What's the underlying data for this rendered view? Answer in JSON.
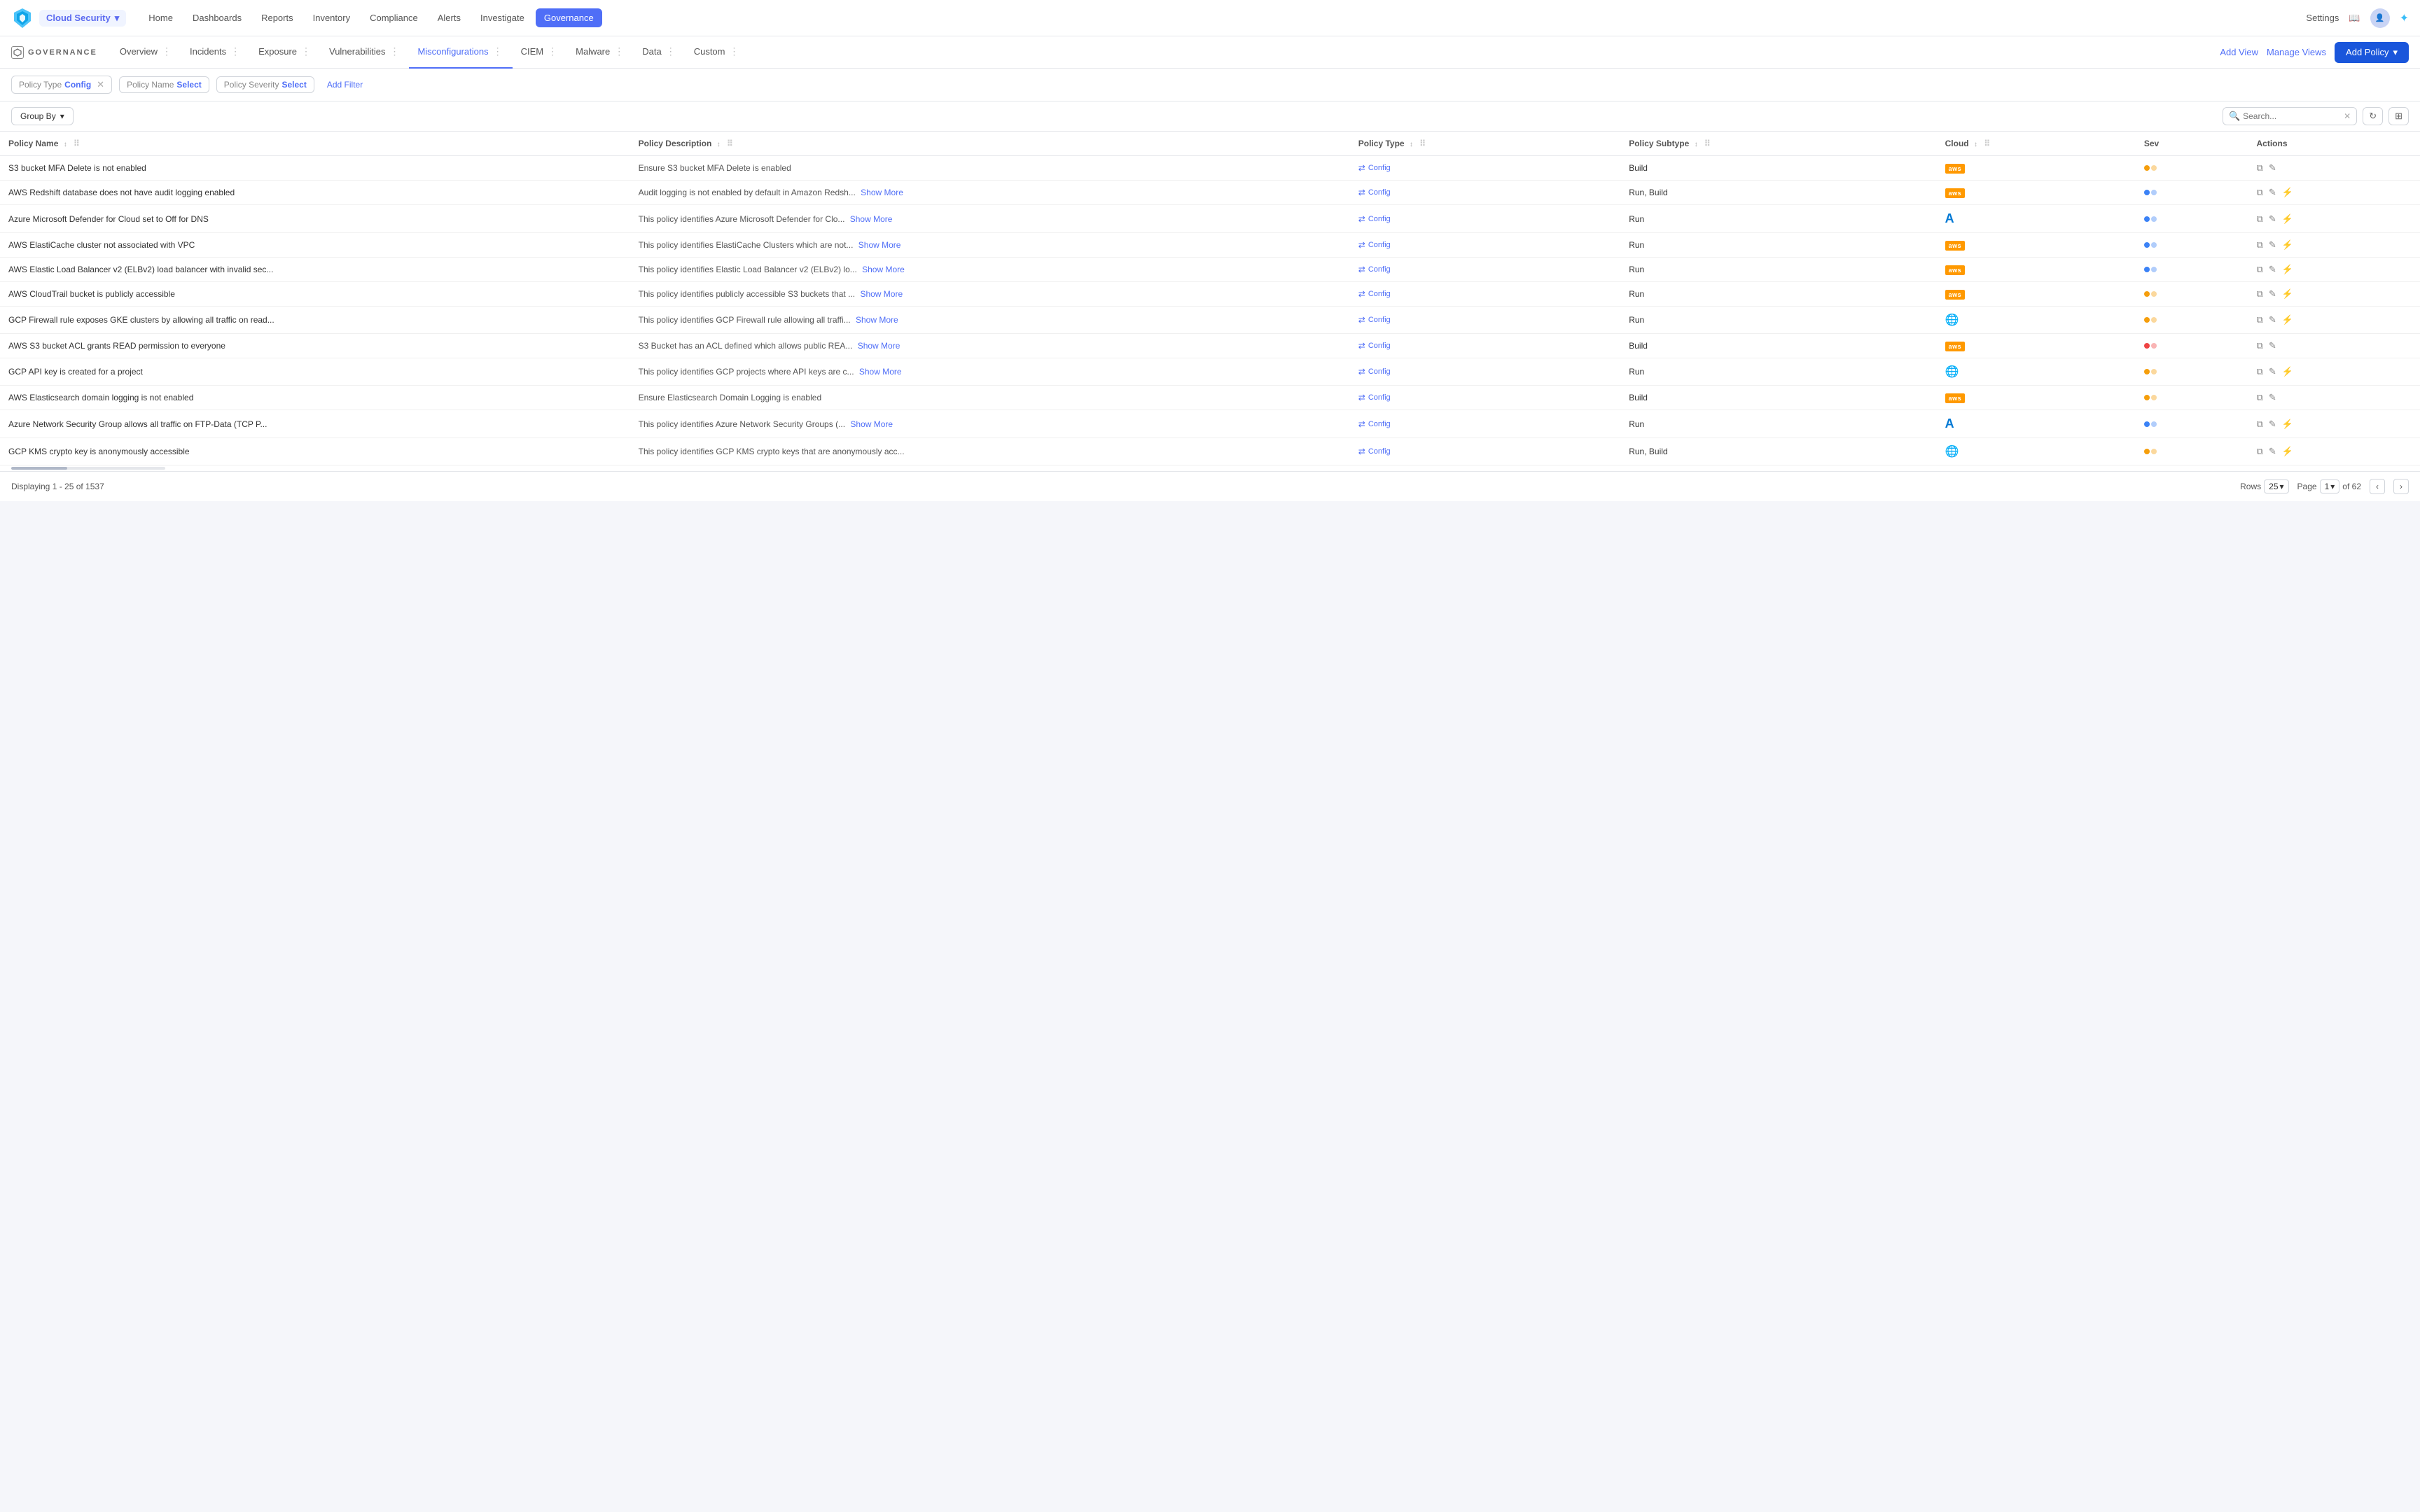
{
  "topNav": {
    "appSwitcher": "Cloud Security",
    "navItems": [
      "Home",
      "Dashboards",
      "Reports",
      "Inventory",
      "Compliance",
      "Alerts",
      "Investigate",
      "Governance"
    ],
    "activeNavItem": "Governance",
    "rightItems": [
      "Settings"
    ],
    "icons": [
      "book-icon",
      "user-icon",
      "star-icon"
    ]
  },
  "subNav": {
    "logoTitle": "GOVERNANCE",
    "items": [
      "Overview",
      "Incidents",
      "Exposure",
      "Vulnerabilities",
      "Misconfigurations",
      "CIEM",
      "Malware",
      "Data",
      "Custom"
    ],
    "activeItem": "Misconfigurations",
    "addViewLabel": "Add View",
    "manageViewsLabel": "Manage Views",
    "addPolicyLabel": "Add Policy"
  },
  "filters": {
    "chips": [
      {
        "label": "Policy Type",
        "value": "Config",
        "removable": true
      },
      {
        "label": "Policy Name",
        "value": "Select",
        "removable": false
      },
      {
        "label": "Policy Severity",
        "value": "Select",
        "removable": false
      }
    ],
    "addFilterLabel": "Add Filter"
  },
  "toolbar": {
    "groupByLabel": "Group By",
    "searchPlaceholder": "Search..."
  },
  "table": {
    "columns": [
      {
        "id": "policy-name",
        "label": "Policy Name",
        "sortable": true
      },
      {
        "id": "policy-description",
        "label": "Policy Description",
        "sortable": true
      },
      {
        "id": "policy-type",
        "label": "Policy Type",
        "sortable": true
      },
      {
        "id": "policy-subtype",
        "label": "Policy Subtype",
        "sortable": true
      },
      {
        "id": "cloud",
        "label": "Cloud",
        "sortable": true
      },
      {
        "id": "severity",
        "label": "Sev",
        "sortable": false
      },
      {
        "id": "actions",
        "label": "Actions",
        "sortable": false
      }
    ],
    "rows": [
      {
        "id": 1,
        "policyName": "S3 bucket MFA Delete is not enabled",
        "policyDescription": "Ensure S3 bucket MFA Delete is enabled",
        "policyType": "Config",
        "policySubtype": "Build",
        "cloud": "aws",
        "severity": "orange",
        "showMore": false
      },
      {
        "id": 2,
        "policyName": "AWS Redshift database does not have audit logging enabled",
        "policyDescription": "Audit logging is not enabled by default in Amazon Redsh...",
        "policyType": "Config",
        "policySubtype": "Run, Build",
        "cloud": "aws",
        "severity": "blue",
        "showMore": true
      },
      {
        "id": 3,
        "policyName": "Azure Microsoft Defender for Cloud set to Off for DNS",
        "policyDescription": "This policy identifies Azure Microsoft Defender for Clo...",
        "policyType": "Config",
        "policySubtype": "Run",
        "cloud": "azure",
        "severity": "blue",
        "showMore": true
      },
      {
        "id": 4,
        "policyName": "AWS ElastiCache cluster not associated with VPC",
        "policyDescription": "This policy identifies ElastiCache Clusters which are not...",
        "policyType": "Config",
        "policySubtype": "Run",
        "cloud": "aws",
        "severity": "blue",
        "showMore": true
      },
      {
        "id": 5,
        "policyName": "AWS Elastic Load Balancer v2 (ELBv2) load balancer with invalid sec...",
        "policyDescription": "This policy identifies Elastic Load Balancer v2 (ELBv2) lo...",
        "policyType": "Config",
        "policySubtype": "Run",
        "cloud": "aws",
        "severity": "blue",
        "showMore": true
      },
      {
        "id": 6,
        "policyName": "AWS CloudTrail bucket is publicly accessible",
        "policyDescription": "This policy identifies publicly accessible S3 buckets that ...",
        "policyType": "Config",
        "policySubtype": "Run",
        "cloud": "aws",
        "severity": "orange",
        "showMore": true
      },
      {
        "id": 7,
        "policyName": "GCP Firewall rule exposes GKE clusters by allowing all traffic on read...",
        "policyDescription": "This policy identifies GCP Firewall rule allowing all traffi...",
        "policyType": "Config",
        "policySubtype": "Run",
        "cloud": "gcp",
        "severity": "orange",
        "showMore": true
      },
      {
        "id": 8,
        "policyName": "AWS S3 bucket ACL grants READ permission to everyone",
        "policyDescription": "S3 Bucket has an ACL defined which allows public REA...",
        "policyType": "Config",
        "policySubtype": "Build",
        "cloud": "aws",
        "severity": "red",
        "showMore": true
      },
      {
        "id": 9,
        "policyName": "GCP API key is created for a project",
        "policyDescription": "This policy identifies GCP projects where API keys are c...",
        "policyType": "Config",
        "policySubtype": "Run",
        "cloud": "gcp",
        "severity": "orange",
        "showMore": true
      },
      {
        "id": 10,
        "policyName": "AWS Elasticsearch domain logging is not enabled",
        "policyDescription": "Ensure Elasticsearch Domain Logging is enabled",
        "policyType": "Config",
        "policySubtype": "Build",
        "cloud": "aws",
        "severity": "orange",
        "showMore": false
      },
      {
        "id": 11,
        "policyName": "Azure Network Security Group allows all traffic on FTP-Data (TCP P...",
        "policyDescription": "This policy identifies Azure Network Security Groups (...",
        "policyType": "Config",
        "policySubtype": "Run",
        "cloud": "azure",
        "severity": "blue",
        "showMore": true
      },
      {
        "id": 12,
        "policyName": "GCP KMS crypto key is anonymously accessible",
        "policyDescription": "This policy identifies GCP KMS crypto keys that are anonymously acc...",
        "policyType": "Config",
        "policySubtype": "Run, Build",
        "cloud": "gcp",
        "severity": "orange",
        "showMore": false
      }
    ],
    "showMoreLabel": "Show More"
  },
  "pagination": {
    "displayText": "Displaying 1 - 25 of 1537",
    "rowsLabel": "Rows",
    "rowsValue": "25",
    "pageLabel": "Page",
    "pageValue": "1",
    "totalPagesLabel": "of 62"
  }
}
